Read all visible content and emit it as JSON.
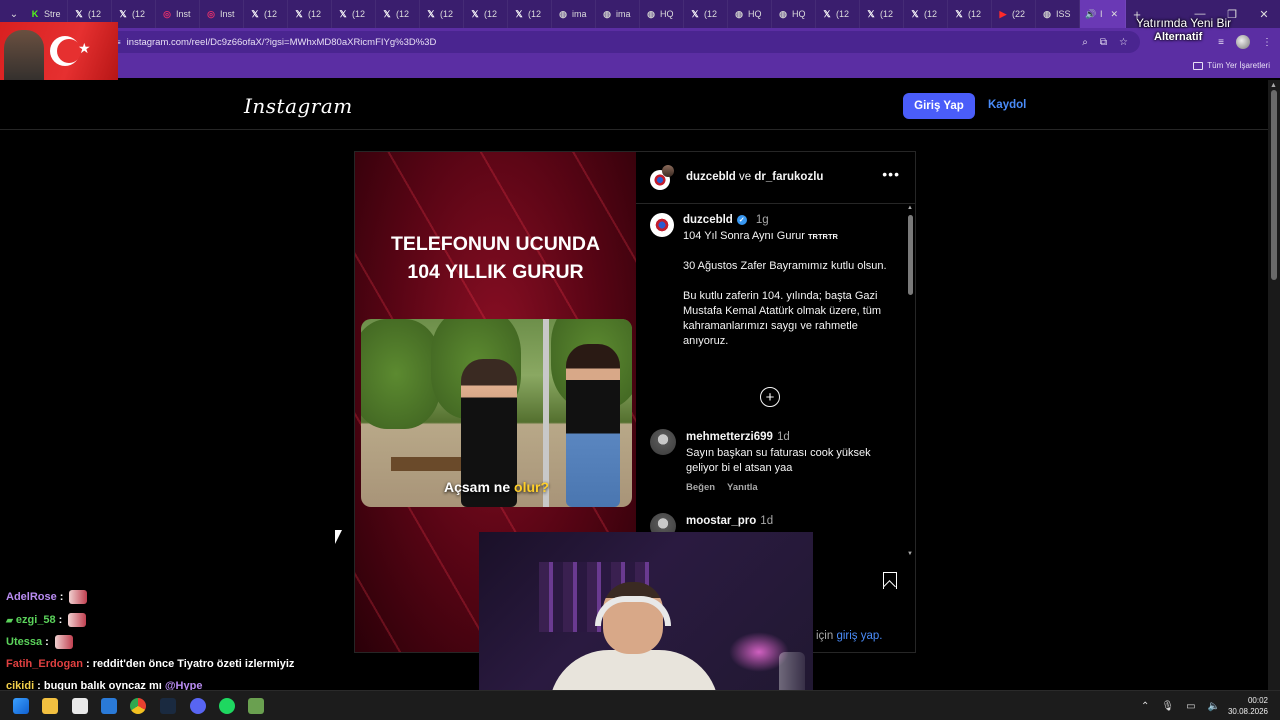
{
  "browser": {
    "tabs": [
      {
        "title": "Stre",
        "icon": "kick-icon"
      },
      {
        "title": "(12",
        "icon": "x-icon"
      },
      {
        "title": "(12",
        "icon": "x-icon"
      },
      {
        "title": "Inst",
        "icon": "instagram-icon"
      },
      {
        "title": "Inst",
        "icon": "instagram-icon"
      },
      {
        "title": "(12",
        "icon": "x-icon"
      },
      {
        "title": "(12",
        "icon": "x-icon"
      },
      {
        "title": "(12",
        "icon": "x-icon"
      },
      {
        "title": "(12",
        "icon": "x-icon"
      },
      {
        "title": "(12",
        "icon": "x-icon"
      },
      {
        "title": "(12",
        "icon": "x-icon"
      },
      {
        "title": "(12",
        "icon": "x-icon"
      },
      {
        "title": "ima",
        "icon": "globe-icon"
      },
      {
        "title": "ima",
        "icon": "globe-icon"
      },
      {
        "title": "HQ",
        "icon": "globe-icon"
      },
      {
        "title": "(12",
        "icon": "x-icon"
      },
      {
        "title": "HQ",
        "icon": "globe-icon"
      },
      {
        "title": "HQ",
        "icon": "globe-icon"
      },
      {
        "title": "(12",
        "icon": "x-icon"
      },
      {
        "title": "(12",
        "icon": "x-icon"
      },
      {
        "title": "(12",
        "icon": "x-icon"
      },
      {
        "title": "(12",
        "icon": "x-icon"
      },
      {
        "title": "(22",
        "icon": "youtube-icon"
      },
      {
        "title": "ISS",
        "icon": "globe-icon"
      },
      {
        "title": "I",
        "icon": "speaker-icon",
        "active": true
      }
    ],
    "url": "instagram.com/reel/Dc9z66ofaX/?igsi=MWhxMD80aXRicmFIYg%3D%3D",
    "bookmarks_folder": "Tüm Yer İşaretleri"
  },
  "overlay": {
    "top_right_line1": "Yatırımda Yeni Bir",
    "top_right_line2": "Alternatif"
  },
  "instagram": {
    "logo": "Instagram",
    "login_button": "Giriş Yap",
    "signup_link": "Kaydol",
    "post": {
      "header_user1": "duzcebld",
      "header_joiner": "ve",
      "header_user2": "dr_farukozlu",
      "media_headline_line1": "TELEFONUN UCUNDA",
      "media_headline_line2": "104 YILLIK GURUR",
      "media_caption_part1": "Açsam ne ",
      "media_caption_part2": "olur?",
      "caption_user": "duzcebld",
      "caption_time": "1g",
      "caption_title": "104 Yıl Sonra Aynı Gurur",
      "caption_tag": "TRTRTR",
      "caption_body": "30 Ağustos Zafer Bayramımız kutlu olsun.\n\nBu kutlu zaferin 104. yılında; başta Gazi Mustafa Kemal Atatürk olmak üzere, tüm kahramanlarımızı saygı ve rahmetle anıyoruz.",
      "comments": [
        {
          "user": "mehmetterzi699",
          "time": "1d",
          "text": "Sayın başkan su faturası cook yüksek geliyor bi el atsan yaa",
          "like": "Beğen",
          "reply": "Yanıtla"
        },
        {
          "user": "moostar_pro",
          "time": "1d",
          "text": "",
          "like": "",
          "reply": ""
        }
      ],
      "login_prompt_prefix": "için",
      "login_prompt_link": "giriş yap."
    }
  },
  "chat": [
    {
      "user": "AdelRose",
      "message": ":",
      "color": "#b98cf2"
    },
    {
      "user": "ezgi_58",
      "message": ":",
      "color": "#5bd35b"
    },
    {
      "user": "Utessa",
      "message": ":",
      "color": "#5bd35b"
    },
    {
      "user": "Fatih_Erdogan",
      "message": ": reddit'den önce Tiyatro özeti izlermiyiz",
      "color": "#e04040"
    },
    {
      "user": "cikidi",
      "message": ": bugun balık oyncaz mı",
      "mention": "@Hype",
      "color": "#f2d04a"
    }
  ],
  "taskbar": {
    "time": "00:02",
    "date": "30.08.2026"
  }
}
